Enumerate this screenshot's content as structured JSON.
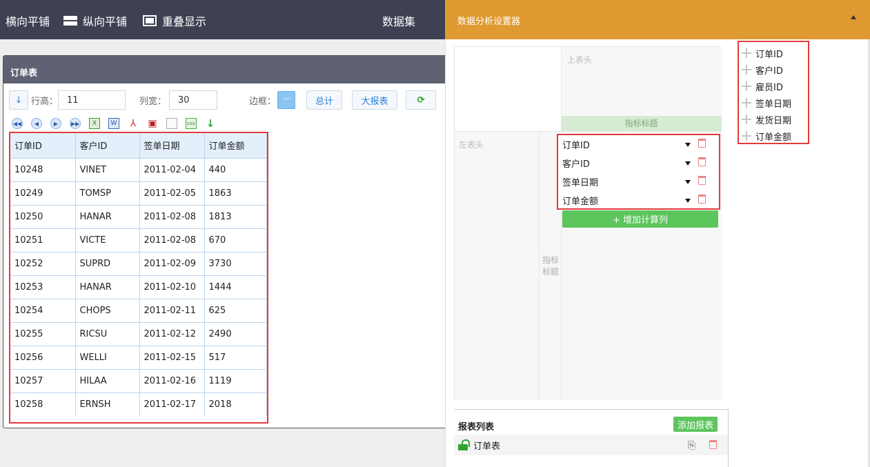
{
  "topbar": {
    "horizontal": "横向平铺",
    "vertical": "纵向平铺",
    "overlap": "重叠显示",
    "dataset": "数据集"
  },
  "report_window": {
    "title": "订单表",
    "toolbar": {
      "sort_icon": "↓",
      "row_height_label": "行高：",
      "row_height_value": "11",
      "col_width_label": "列宽：",
      "col_width_value": "30",
      "border_label": "边框：",
      "total_label": "总计",
      "big_report_label": "大报表",
      "refresh_icon": "refresh-icon"
    },
    "table": {
      "headers": [
        "订单ID",
        "客户ID",
        "签单日期",
        "订单金额"
      ],
      "rows": [
        [
          "10248",
          "VINET",
          "2011-02-04",
          "440"
        ],
        [
          "10249",
          "TOMSP",
          "2011-02-05",
          "1863"
        ],
        [
          "10250",
          "HANAR",
          "2011-02-08",
          "1813"
        ],
        [
          "10251",
          "VICTE",
          "2011-02-08",
          "670"
        ],
        [
          "10252",
          "SUPRD",
          "2011-02-09",
          "3730"
        ],
        [
          "10253",
          "HANAR",
          "2011-02-10",
          "1444"
        ],
        [
          "10254",
          "CHOPS",
          "2011-02-11",
          "625"
        ],
        [
          "10255",
          "RICSU",
          "2011-02-12",
          "2490"
        ],
        [
          "10256",
          "WELLI",
          "2011-02-15",
          "517"
        ],
        [
          "10257",
          "HILAA",
          "2011-02-16",
          "1119"
        ],
        [
          "10258",
          "ERNSH",
          "2011-02-17",
          "2018"
        ]
      ]
    }
  },
  "analysis_panel": {
    "title": "数据分析设置器",
    "top_header_placeholder": "上表头",
    "indicator_band": "指标标题",
    "left_header_placeholder": "左表头",
    "indicator_vertical": "指标标题",
    "selected_fields": [
      "订单ID",
      "客户ID",
      "签单日期",
      "订单金额"
    ],
    "add_calc_column": "+ 增加计算列",
    "report_list_title": "报表列表",
    "add_report": "添加报表",
    "report_item": "订单表",
    "available_fields": [
      "订单ID",
      "客户ID",
      "雇员ID",
      "签单日期",
      "发货日期",
      "订单金额"
    ]
  },
  "colors": {
    "topbar": "#3e4152",
    "panel_header": "#df9a31",
    "highlight": "#e23b3b",
    "green": "#5cc55c"
  }
}
